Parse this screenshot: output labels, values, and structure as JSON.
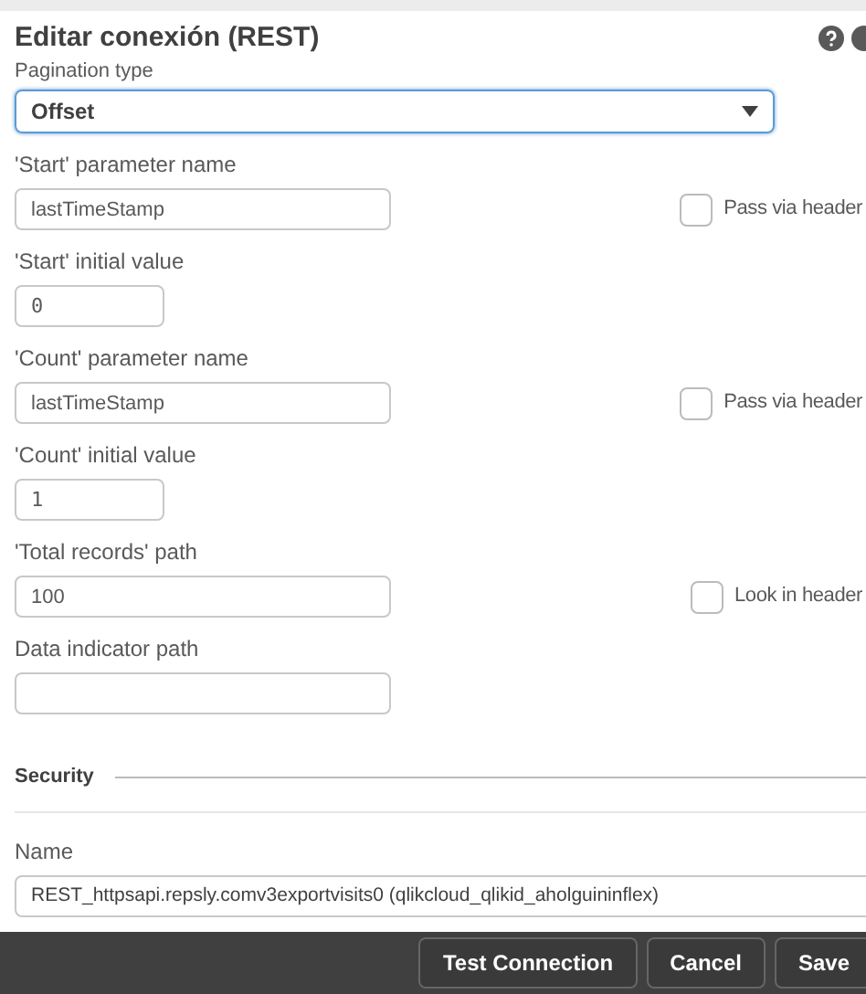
{
  "window": {
    "title": "Editar conexión (REST)"
  },
  "pagination": {
    "label": "Pagination type",
    "value": "Offset"
  },
  "fields": [
    {
      "kind": "wide",
      "label": "'Start' parameter name",
      "value": "lastTimeStamp",
      "checkbox": {
        "label": "Pass via header",
        "checked": false
      }
    },
    {
      "kind": "narrow",
      "label": "'Start' initial value",
      "value": "0"
    },
    {
      "kind": "wide",
      "label": "'Count' parameter name",
      "value": "lastTimeStamp",
      "checkbox": {
        "label": "Pass via header",
        "checked": false
      }
    },
    {
      "kind": "narrow",
      "label": "'Count' initial value",
      "value": "1"
    },
    {
      "kind": "wide",
      "label": "'Total records' path",
      "value": "100",
      "checkbox": {
        "label": "Look in header",
        "checked": false
      }
    },
    {
      "kind": "wide",
      "label": "Data indicator path"
    }
  ],
  "security": {
    "heading": "Security"
  },
  "name_field": {
    "label": "Name",
    "value": "REST_httpsapi.repsly.comv3exportvisits0 (qlikcloud_qlikid_aholguininflex)"
  },
  "buttons": [
    "Test Connection",
    "Cancel",
    "Save"
  ]
}
